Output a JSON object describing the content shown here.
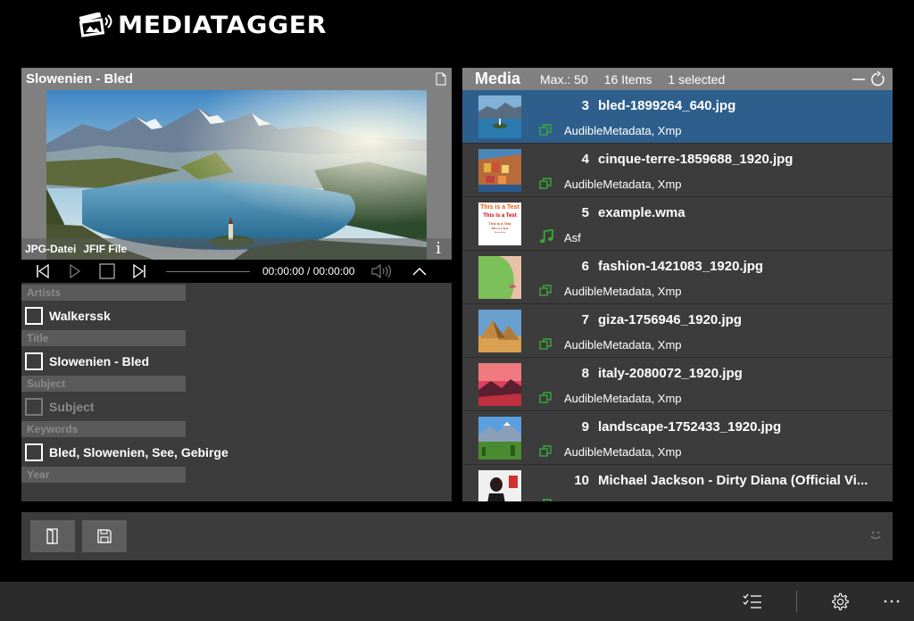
{
  "app": {
    "logo_text": "MEDIATAGGER"
  },
  "preview": {
    "title": "Slowenien - Bled",
    "file_type": "JPG-Datei",
    "file_format": "JFIF File",
    "time": "00:00:00 / 00:00:00"
  },
  "metadata": {
    "fields": [
      {
        "label": "Artists",
        "value": "Walkerssk",
        "enabled": true
      },
      {
        "label": "Title",
        "value": "Slowenien - Bled",
        "enabled": true
      },
      {
        "label": "Subject",
        "value": "Subject",
        "enabled": false
      },
      {
        "label": "Keywords",
        "value": "Bled, Slowenien, See, Gebirge",
        "enabled": true
      },
      {
        "label": "Year",
        "value": "",
        "enabled": true
      }
    ]
  },
  "media": {
    "title": "Media",
    "max": "Max.: 50",
    "count": "16 Items",
    "selected": "1 selected",
    "items": [
      {
        "num": "3",
        "name": "bled-1899264_640.jpg",
        "tags": "AudibleMetadata, Xmp",
        "kind": "image",
        "selected": true
      },
      {
        "num": "4",
        "name": "cinque-terre-1859688_1920.jpg",
        "tags": "AudibleMetadata, Xmp",
        "kind": "image",
        "selected": false
      },
      {
        "num": "5",
        "name": "example.wma",
        "tags": "Asf",
        "kind": "audio",
        "selected": false
      },
      {
        "num": "6",
        "name": "fashion-1421083_1920.jpg",
        "tags": "AudibleMetadata, Xmp",
        "kind": "image",
        "selected": false
      },
      {
        "num": "7",
        "name": "giza-1756946_1920.jpg",
        "tags": "AudibleMetadata, Xmp",
        "kind": "image",
        "selected": false
      },
      {
        "num": "8",
        "name": "italy-2080072_1920.jpg",
        "tags": "AudibleMetadata, Xmp",
        "kind": "image",
        "selected": false
      },
      {
        "num": "9",
        "name": "landscape-1752433_1920.jpg",
        "tags": "AudibleMetadata, Xmp",
        "kind": "image",
        "selected": false
      },
      {
        "num": "10",
        "name": "Michael Jackson - Dirty Diana (Official Vi...",
        "tags": "",
        "kind": "video",
        "selected": false
      }
    ]
  },
  "thumb5": {
    "line1": "This is a Test",
    "line2": "This is a Test",
    "line3": "This is a Test",
    "line4": "This is a Test",
    "line5": "This is a Test"
  },
  "icons": {
    "document": "document-icon",
    "info": "i",
    "music": "music-note-icon",
    "copy": "copy-icon"
  },
  "colors": {
    "accent_selected": "#2e5f8c",
    "icon_green": "#3aa83a",
    "panel_bg": "#3c3c3c",
    "header_bg": "#808080"
  }
}
